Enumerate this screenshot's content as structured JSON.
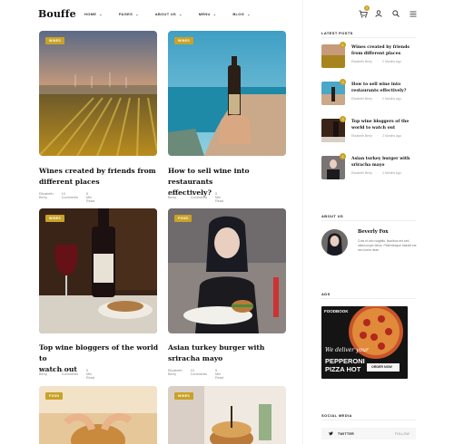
{
  "header": {
    "logo": "Bouffe",
    "nav": [
      {
        "label": "HOME"
      },
      {
        "label": "PAGES"
      },
      {
        "label": "ABOUT US"
      },
      {
        "label": "MENU"
      },
      {
        "label": "BLOG"
      }
    ],
    "cart_count": "0"
  },
  "posts": [
    {
      "tag": "WINES",
      "title_line1": "Wines created by friends from",
      "title_line2": "different places",
      "author": "Elizabeth Berry",
      "comments": "10 Comments",
      "read": "5 Min Read"
    },
    {
      "tag": "WINES",
      "title_line1": "How to sell wine into restaurants",
      "title_line2": "effectively?",
      "author": "Elizabeth Berry",
      "comments": "10 Comments",
      "read": "5 Min Read"
    },
    {
      "tag": "WINES",
      "title_line1": "Top wine bloggers of the world to",
      "title_line2": "watch out",
      "author": "Elizabeth Berry",
      "comments": "10 Comments",
      "read": "5 Min Read"
    },
    {
      "tag": "FOOD",
      "title_line1": "Asian turkey burger with",
      "title_line2": "sriracha mayo",
      "author": "Elizabeth Berry",
      "comments": "10 Comments",
      "read": "5 Min Read"
    },
    {
      "tag": "FOOD"
    },
    {
      "tag": "WINES"
    }
  ],
  "sidebar": {
    "latest_heading": "LATEST POSTS",
    "latest": [
      {
        "num": "1",
        "title_line1": "Wines created by friends",
        "title_line2": "from different places",
        "author": "Elizabeth Berry",
        "time": "2 Months Ago"
      },
      {
        "num": "2",
        "title_line1": "How to sell wine into",
        "title_line2": "restaurants effectively?",
        "author": "Elizabeth Berry",
        "time": "2 Months Ago"
      },
      {
        "num": "3",
        "title_line1": "Top wine bloggers of the",
        "title_line2": "world to watch out",
        "author": "Elizabeth Berry",
        "time": "2 Months Ago"
      },
      {
        "num": "4",
        "title_line1": "Asian turkey burger with",
        "title_line2": "sriracha mayo",
        "author": "Elizabeth Berry",
        "time": "2 Months Ago"
      }
    ],
    "about_heading": "ABOUT US",
    "about_name": "Beverly Fox",
    "about_text": "Cras et arcu sagittis, faucibus est sed, ullamcorper tellus. Pellentesque blandit est nec lorem vitae.",
    "ads_heading": "ADS",
    "ad": {
      "brand": "FOODBOOK",
      "line1": "We deliver your",
      "line2": "PEPPERONI",
      "line3": "PIZZA HOT",
      "cta": "ORDER NOW"
    },
    "social_heading": "SOCIAL MEDIA",
    "social": {
      "label": "TWITTER",
      "action": "FOLLOW"
    }
  },
  "colors": {
    "accent": "#c9a227"
  }
}
